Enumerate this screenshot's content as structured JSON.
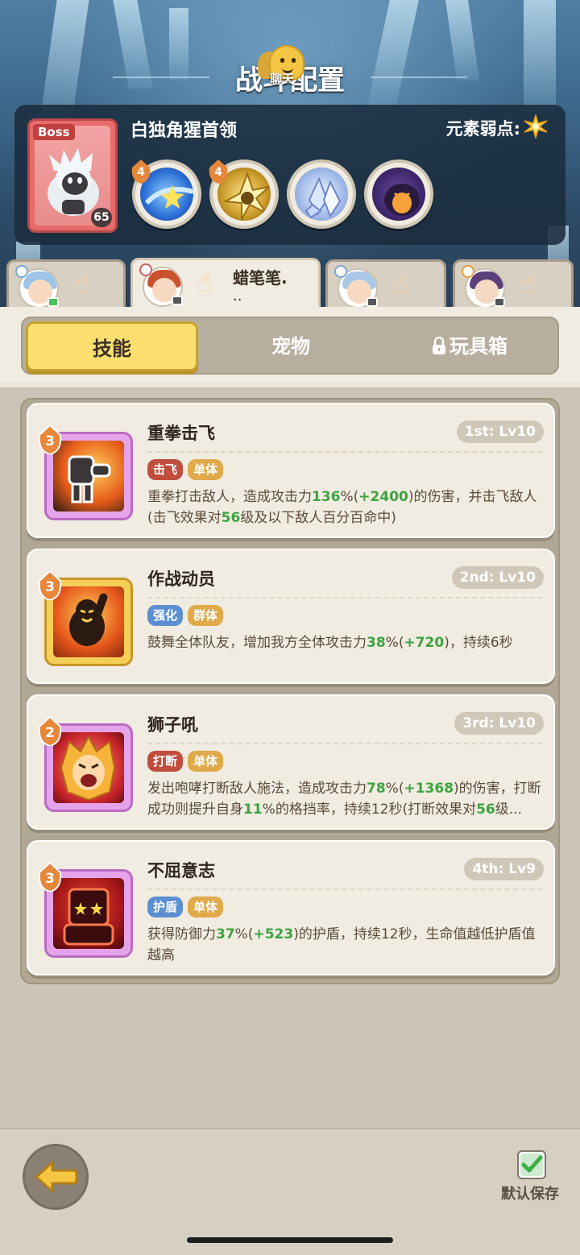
{
  "header": {
    "title": "战斗配置",
    "chat_label": "聊天"
  },
  "boss": {
    "tag": "Boss",
    "level": "65",
    "name": "白独角猩首领",
    "weakness_label": "元素弱点:",
    "weakness_icon": "spark-icon",
    "skill_orbs": [
      {
        "icon": "star-swirl-icon",
        "badge": "4"
      },
      {
        "icon": "golden-burst-icon",
        "badge": "4"
      },
      {
        "icon": "ice-crystal-icon",
        "badge": ""
      },
      {
        "icon": "dark-monster-face-icon",
        "badge": ""
      }
    ]
  },
  "heroes": [
    {
      "icon": "hero-avatar-blue-hair",
      "name": "",
      "sub": ""
    },
    {
      "icon": "hero-avatar-red-hair",
      "name": "蜡笔笔.",
      "sub": ".."
    },
    {
      "icon": "hero-avatar-blue-hair",
      "name": "",
      "sub": ""
    },
    {
      "icon": "hero-avatar-purple-hair",
      "name": "",
      "sub": ""
    }
  ],
  "tabs": {
    "skills": "技能",
    "pets": "宠物",
    "toybox": "玩具箱"
  },
  "skills": [
    {
      "name": "重拳击飞",
      "rank": "1st: Lv10",
      "badge": "3",
      "tags": [
        "击飞",
        "单体"
      ],
      "desc_parts": [
        "重拳打击敌人，造成攻击力",
        "136",
        "%(",
        "+2400",
        ")的伤害，并击飞敌人(击飞效果对",
        "56",
        "级及以下敌人百分百命中)"
      ]
    },
    {
      "name": "作战动员",
      "rank": "2nd: Lv10",
      "badge": "3",
      "tags": [
        "强化",
        "群体"
      ],
      "desc_parts": [
        "鼓舞全体队友，增加我方全体攻击力",
        "38",
        "%(",
        "+720",
        ")，持续6秒"
      ]
    },
    {
      "name": "狮子吼",
      "rank": "3rd: Lv10",
      "badge": "2",
      "tags": [
        "打断",
        "单体"
      ],
      "desc_parts": [
        "发出咆哮打断敌人施法，造成攻击力",
        "78",
        "%(",
        "+1368",
        ")的伤害，打断成功则提升自身",
        "11",
        "%的格挡率，持续12秒(打断效果对",
        "56",
        "级..."
      ]
    },
    {
      "name": "不屈意志",
      "rank": "4th: Lv9",
      "badge": "3",
      "tags": [
        "护盾",
        "单体"
      ],
      "desc_parts": [
        "获得防御力",
        "37",
        "%(",
        "+523",
        ")的护盾，持续12秒，生命值越低护盾值越高"
      ]
    }
  ],
  "footer": {
    "back_icon": "arrow-left-icon",
    "save_label": "默认保存",
    "save_checked": true
  },
  "colors": {
    "highlight_green": "#3ca33f",
    "tab_active": "#fbe071"
  }
}
